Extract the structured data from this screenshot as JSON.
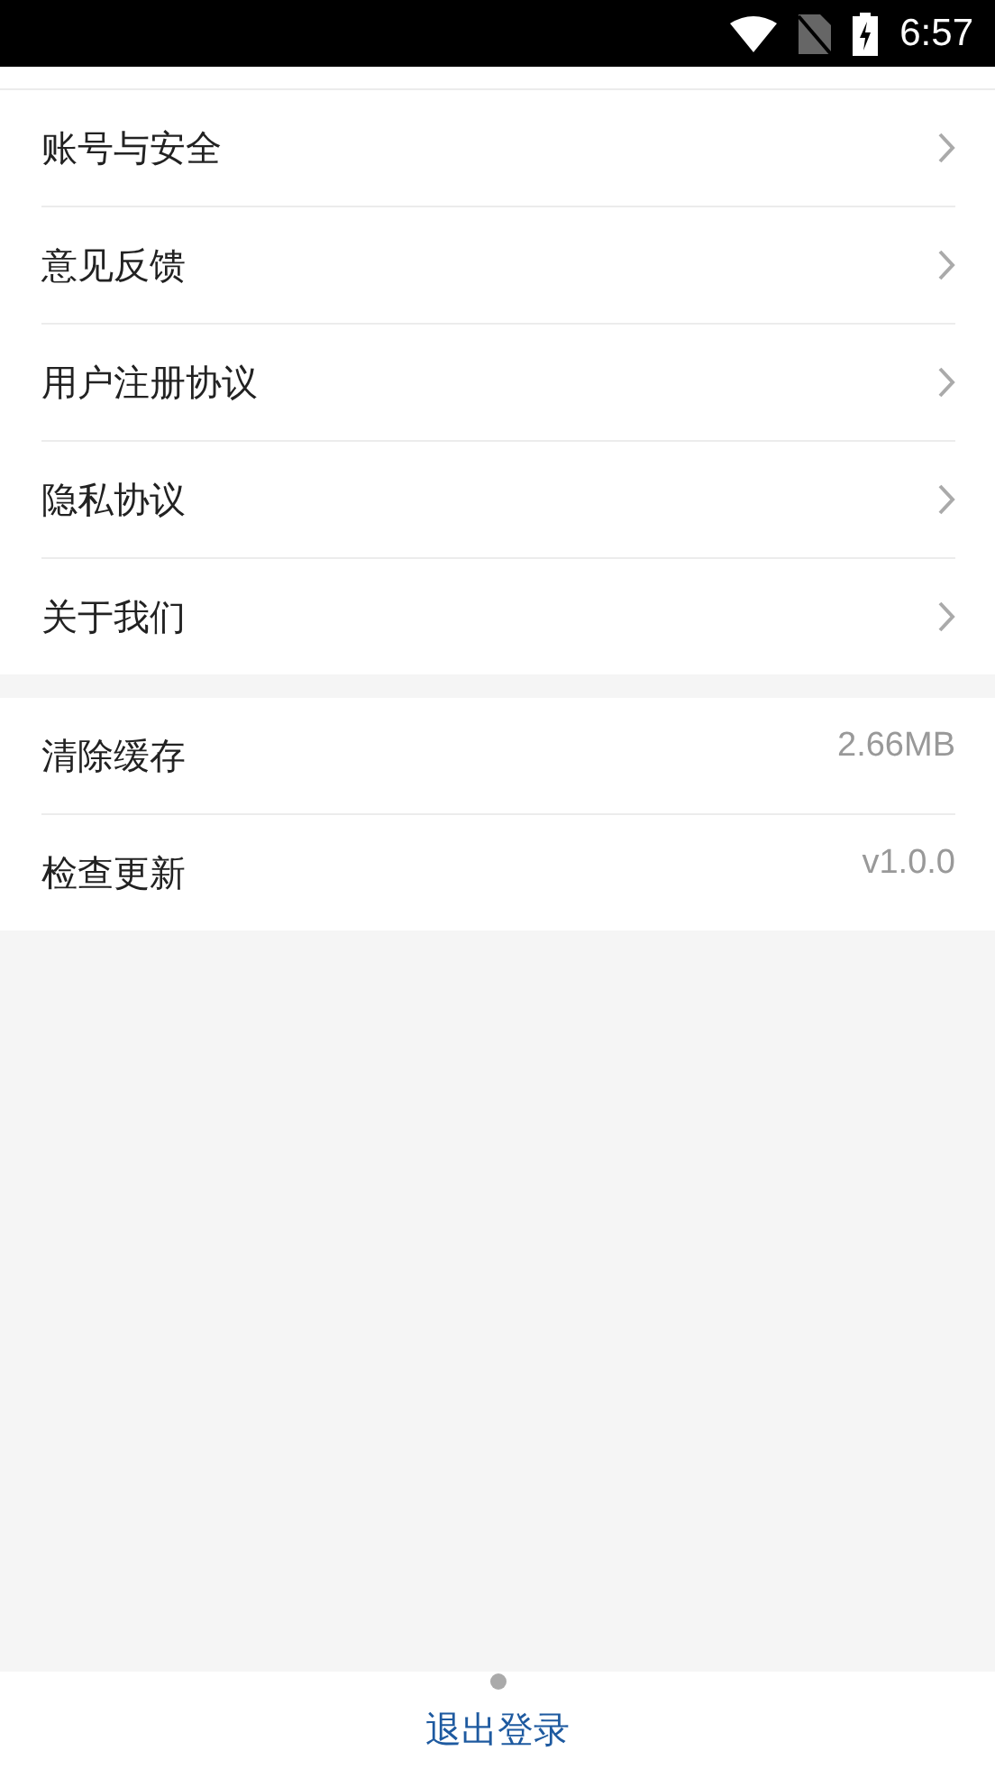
{
  "status_bar": {
    "time": "6:57"
  },
  "menu_items": [
    {
      "label": "账号与安全"
    },
    {
      "label": "意见反馈"
    },
    {
      "label": "用户注册协议"
    },
    {
      "label": "隐私协议"
    },
    {
      "label": "关于我们"
    }
  ],
  "info_items": [
    {
      "label": "清除缓存",
      "value": "2.66MB"
    },
    {
      "label": "检查更新",
      "value": "v1.0.0"
    }
  ],
  "logout_button": {
    "label": "退出登录"
  }
}
